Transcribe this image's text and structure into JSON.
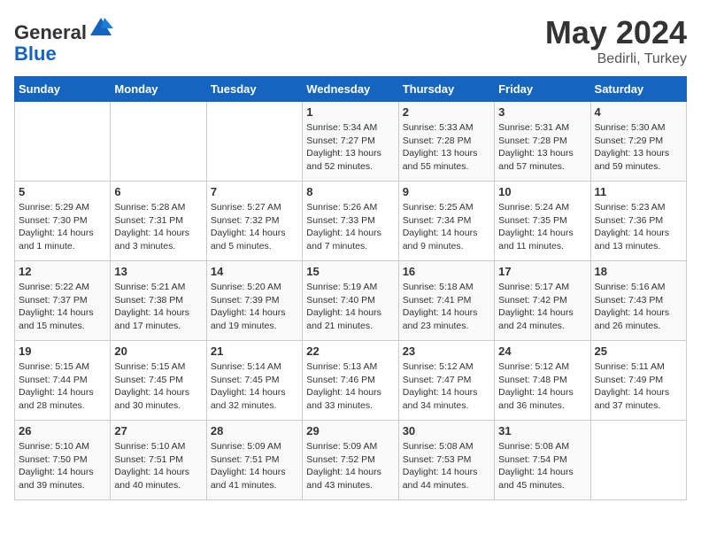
{
  "header": {
    "logo_general": "General",
    "logo_blue": "Blue",
    "month": "May 2024",
    "location": "Bedirli, Turkey"
  },
  "days_of_week": [
    "Sunday",
    "Monday",
    "Tuesday",
    "Wednesday",
    "Thursday",
    "Friday",
    "Saturday"
  ],
  "weeks": [
    [
      {
        "day": "",
        "info": ""
      },
      {
        "day": "",
        "info": ""
      },
      {
        "day": "",
        "info": ""
      },
      {
        "day": "1",
        "info": "Sunrise: 5:34 AM\nSunset: 7:27 PM\nDaylight: 13 hours\nand 52 minutes."
      },
      {
        "day": "2",
        "info": "Sunrise: 5:33 AM\nSunset: 7:28 PM\nDaylight: 13 hours\nand 55 minutes."
      },
      {
        "day": "3",
        "info": "Sunrise: 5:31 AM\nSunset: 7:28 PM\nDaylight: 13 hours\nand 57 minutes."
      },
      {
        "day": "4",
        "info": "Sunrise: 5:30 AM\nSunset: 7:29 PM\nDaylight: 13 hours\nand 59 minutes."
      }
    ],
    [
      {
        "day": "5",
        "info": "Sunrise: 5:29 AM\nSunset: 7:30 PM\nDaylight: 14 hours\nand 1 minute."
      },
      {
        "day": "6",
        "info": "Sunrise: 5:28 AM\nSunset: 7:31 PM\nDaylight: 14 hours\nand 3 minutes."
      },
      {
        "day": "7",
        "info": "Sunrise: 5:27 AM\nSunset: 7:32 PM\nDaylight: 14 hours\nand 5 minutes."
      },
      {
        "day": "8",
        "info": "Sunrise: 5:26 AM\nSunset: 7:33 PM\nDaylight: 14 hours\nand 7 minutes."
      },
      {
        "day": "9",
        "info": "Sunrise: 5:25 AM\nSunset: 7:34 PM\nDaylight: 14 hours\nand 9 minutes."
      },
      {
        "day": "10",
        "info": "Sunrise: 5:24 AM\nSunset: 7:35 PM\nDaylight: 14 hours\nand 11 minutes."
      },
      {
        "day": "11",
        "info": "Sunrise: 5:23 AM\nSunset: 7:36 PM\nDaylight: 14 hours\nand 13 minutes."
      }
    ],
    [
      {
        "day": "12",
        "info": "Sunrise: 5:22 AM\nSunset: 7:37 PM\nDaylight: 14 hours\nand 15 minutes."
      },
      {
        "day": "13",
        "info": "Sunrise: 5:21 AM\nSunset: 7:38 PM\nDaylight: 14 hours\nand 17 minutes."
      },
      {
        "day": "14",
        "info": "Sunrise: 5:20 AM\nSunset: 7:39 PM\nDaylight: 14 hours\nand 19 minutes."
      },
      {
        "day": "15",
        "info": "Sunrise: 5:19 AM\nSunset: 7:40 PM\nDaylight: 14 hours\nand 21 minutes."
      },
      {
        "day": "16",
        "info": "Sunrise: 5:18 AM\nSunset: 7:41 PM\nDaylight: 14 hours\nand 23 minutes."
      },
      {
        "day": "17",
        "info": "Sunrise: 5:17 AM\nSunset: 7:42 PM\nDaylight: 14 hours\nand 24 minutes."
      },
      {
        "day": "18",
        "info": "Sunrise: 5:16 AM\nSunset: 7:43 PM\nDaylight: 14 hours\nand 26 minutes."
      }
    ],
    [
      {
        "day": "19",
        "info": "Sunrise: 5:15 AM\nSunset: 7:44 PM\nDaylight: 14 hours\nand 28 minutes."
      },
      {
        "day": "20",
        "info": "Sunrise: 5:15 AM\nSunset: 7:45 PM\nDaylight: 14 hours\nand 30 minutes."
      },
      {
        "day": "21",
        "info": "Sunrise: 5:14 AM\nSunset: 7:45 PM\nDaylight: 14 hours\nand 32 minutes."
      },
      {
        "day": "22",
        "info": "Sunrise: 5:13 AM\nSunset: 7:46 PM\nDaylight: 14 hours\nand 33 minutes."
      },
      {
        "day": "23",
        "info": "Sunrise: 5:12 AM\nSunset: 7:47 PM\nDaylight: 14 hours\nand 34 minutes."
      },
      {
        "day": "24",
        "info": "Sunrise: 5:12 AM\nSunset: 7:48 PM\nDaylight: 14 hours\nand 36 minutes."
      },
      {
        "day": "25",
        "info": "Sunrise: 5:11 AM\nSunset: 7:49 PM\nDaylight: 14 hours\nand 37 minutes."
      }
    ],
    [
      {
        "day": "26",
        "info": "Sunrise: 5:10 AM\nSunset: 7:50 PM\nDaylight: 14 hours\nand 39 minutes."
      },
      {
        "day": "27",
        "info": "Sunrise: 5:10 AM\nSunset: 7:51 PM\nDaylight: 14 hours\nand 40 minutes."
      },
      {
        "day": "28",
        "info": "Sunrise: 5:09 AM\nSunset: 7:51 PM\nDaylight: 14 hours\nand 41 minutes."
      },
      {
        "day": "29",
        "info": "Sunrise: 5:09 AM\nSunset: 7:52 PM\nDaylight: 14 hours\nand 43 minutes."
      },
      {
        "day": "30",
        "info": "Sunrise: 5:08 AM\nSunset: 7:53 PM\nDaylight: 14 hours\nand 44 minutes."
      },
      {
        "day": "31",
        "info": "Sunrise: 5:08 AM\nSunset: 7:54 PM\nDaylight: 14 hours\nand 45 minutes."
      },
      {
        "day": "",
        "info": ""
      }
    ]
  ]
}
